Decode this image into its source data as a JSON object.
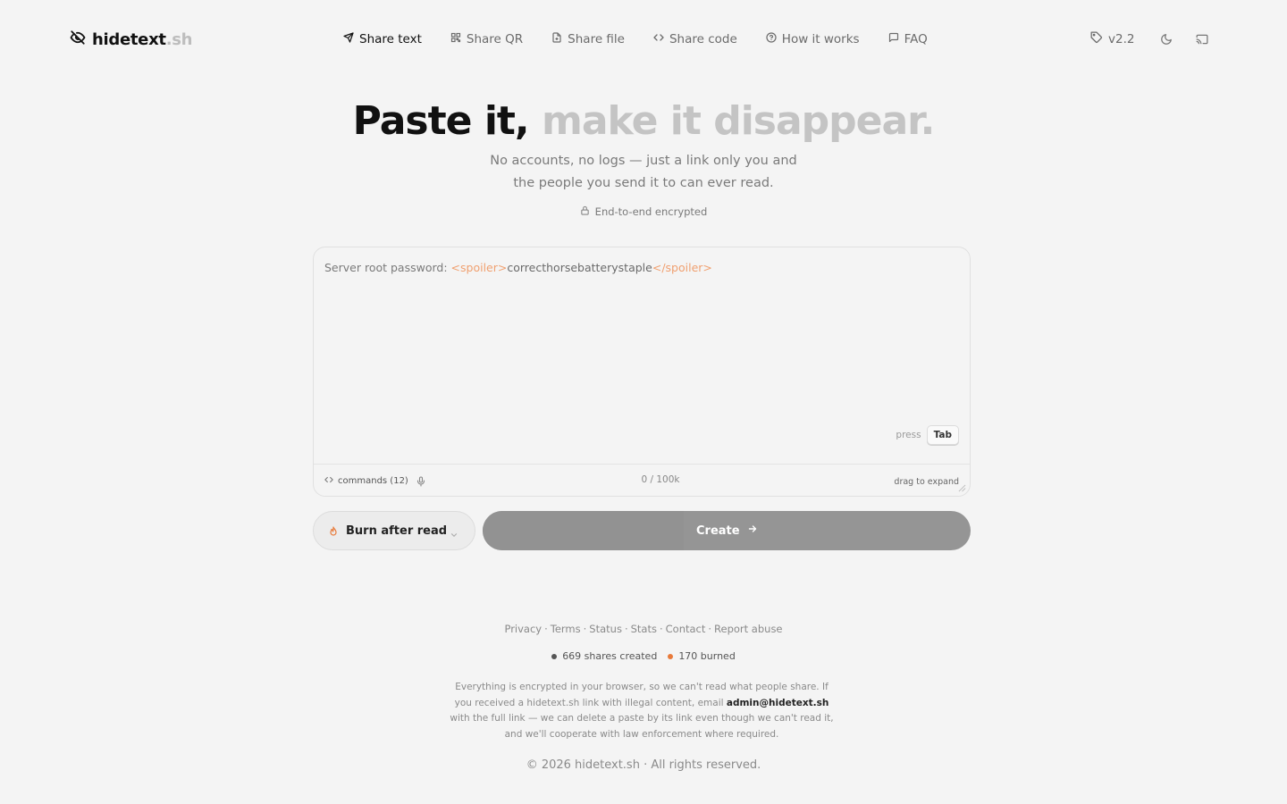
{
  "brand": {
    "name": "hidetext",
    "ext": ".sh"
  },
  "nav": {
    "items": [
      {
        "label": "Share text",
        "icon": "send-icon",
        "active": true
      },
      {
        "label": "Share QR",
        "icon": "qr-icon",
        "active": false
      },
      {
        "label": "Share file",
        "icon": "file-icon",
        "active": false
      },
      {
        "label": "Share code",
        "icon": "code-icon",
        "active": false
      },
      {
        "label": "How it works",
        "icon": "help-circle-icon",
        "active": false
      },
      {
        "label": "FAQ",
        "icon": "message-icon",
        "active": false
      }
    ]
  },
  "header": {
    "version": "v2.2"
  },
  "hero": {
    "title_dark": "Paste it,",
    "title_light": "make it disappear.",
    "subtitle_line1": "No accounts, no logs — just a link only you and",
    "subtitle_line2": "the people you send it to can ever read.",
    "badge": "End-to-end encrypted"
  },
  "editor": {
    "prefix": "Server root password: ",
    "tag_open": "<spoiler>",
    "secret": "correcthorsebatterystaple",
    "tag_close": "</spoiler>",
    "press_label": "press",
    "key": "Tab",
    "commands_label": "commands (12)",
    "counter": "0 / 100k",
    "drag_label": "drag to expand"
  },
  "controls": {
    "burn_label": "Burn after read",
    "create_label": "Create"
  },
  "footer": {
    "links": [
      "Privacy",
      "Terms",
      "Status",
      "Stats",
      "Contact",
      "Report abuse"
    ],
    "shares_created": "669 shares created",
    "burned": "170 burned",
    "legal_before": "Everything is encrypted in your browser, so we can't read what people share. If you received a hidetext.sh link with illegal content, email ",
    "legal_email": "admin@hidetext.sh",
    "legal_after": " with the full link — we can delete a paste by its link even though we can't read it, and we'll cooperate with law enforcement where required.",
    "copyright": "© 2026 hidetext.sh · All rights reserved."
  },
  "colors": {
    "accent": "#e87a3a",
    "background": "#f4f4f4",
    "button": "#959595"
  }
}
